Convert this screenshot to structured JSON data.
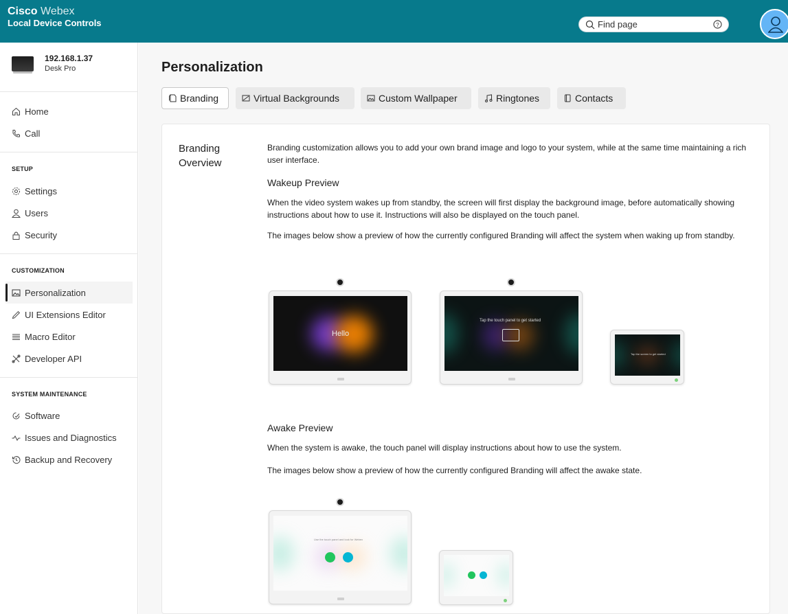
{
  "header": {
    "brand_bold": "Cisco",
    "brand_light": "Webex",
    "subtitle": "Local Device Controls",
    "search_placeholder": "Find page",
    "colors": {
      "bar": "#077a8c",
      "avatar": "#64b5f6"
    }
  },
  "device": {
    "ip": "192.168.1.37",
    "model": "Desk Pro"
  },
  "sidebar": {
    "top_items": [
      {
        "label": "Home",
        "icon": "home-icon"
      },
      {
        "label": "Call",
        "icon": "phone-icon"
      }
    ],
    "sections": [
      {
        "title": "SETUP",
        "items": [
          {
            "label": "Settings",
            "icon": "gear-icon"
          },
          {
            "label": "Users",
            "icon": "user-icon"
          },
          {
            "label": "Security",
            "icon": "lock-icon"
          }
        ]
      },
      {
        "title": "CUSTOMIZATION",
        "items": [
          {
            "label": "Personalization",
            "icon": "image-icon",
            "active": true
          },
          {
            "label": "UI Extensions Editor",
            "icon": "pencil-icon"
          },
          {
            "label": "Macro Editor",
            "icon": "lines-icon"
          },
          {
            "label": "Developer API",
            "icon": "tools-icon"
          }
        ]
      },
      {
        "title": "SYSTEM MAINTENANCE",
        "items": [
          {
            "label": "Software",
            "icon": "software-icon"
          },
          {
            "label": "Issues and Diagnostics",
            "icon": "pulse-icon"
          },
          {
            "label": "Backup and Recovery",
            "icon": "restore-icon"
          }
        ]
      }
    ]
  },
  "main": {
    "title": "Personalization",
    "tabs": [
      {
        "label": "Branding",
        "icon": "branding-icon",
        "active": true
      },
      {
        "label": "Virtual Backgrounds",
        "icon": "background-icon"
      },
      {
        "label": "Custom Wallpaper",
        "icon": "wallpaper-icon"
      },
      {
        "label": "Ringtones",
        "icon": "music-icon"
      },
      {
        "label": "Contacts",
        "icon": "contacts-icon"
      }
    ],
    "overview_title_1": "Branding",
    "overview_title_2": "Overview",
    "intro": "Branding customization allows you to add your own brand image and logo to your system, while at the same time maintaining a rich user interface.",
    "wakeup": {
      "heading": "Wakeup Preview",
      "p1": "When the video system wakes up from standby, the screen will first display the background image, before automatically showing instructions about how to use it. Instructions will also be displayed on the touch panel.",
      "p2": "The images below show a preview of how the currently configured Branding will affect the system when waking up from standby.",
      "hello_text": "Hello",
      "tap_text": "Tap the touch panel to get started",
      "tap_text_small": "Tap the screen to get started"
    },
    "awake": {
      "heading": "Awake Preview",
      "p1": "When the system is awake, the touch panel will display instructions about how to use the system.",
      "p2": "The images below show a preview of how the currently configured Branding will affect the awake state.",
      "use_text": "Use the touch panel and look for Webex"
    }
  }
}
